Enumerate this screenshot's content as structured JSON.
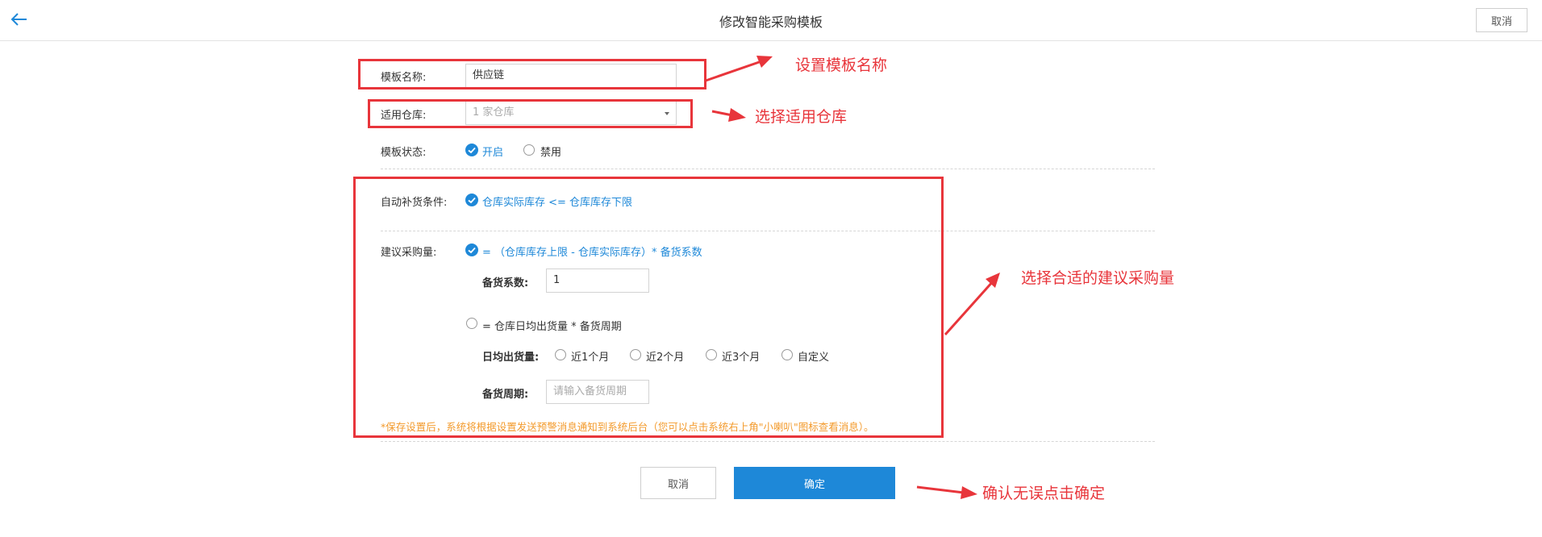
{
  "header": {
    "title": "修改智能采购模板",
    "cancel_label": "取消"
  },
  "form": {
    "name_label": "模板名称:",
    "name_value": "供应链",
    "warehouse_label": "适用仓库:",
    "warehouse_value": "1 家仓库",
    "status_label": "模板状态:",
    "status_on": "开启",
    "status_off": "禁用",
    "auto_label": "自动补货条件:",
    "auto_option": "仓库实际库存 <= 仓库库存下限",
    "qty_label": "建议采购量:",
    "qty_option_1": "= （仓库库存上限 - 仓库实际库存）* 备货系数",
    "coef_label": "备货系数:",
    "coef_value": "1",
    "qty_option_2": "= 仓库日均出货量 * 备货周期",
    "daily_label": "日均出货量:",
    "daily_options": [
      "近1个月",
      "近2个月",
      "近3个月",
      "自定义"
    ],
    "period_label": "备货周期:",
    "period_placeholder": "请输入备货周期",
    "notice": "*保存设置后，系统将根据设置发送预警消息通知到系统后台（您可以点击系统右上角\"小喇叭\"图标查看消息）。"
  },
  "footer": {
    "cancel_label": "取消",
    "confirm_label": "确定"
  },
  "annotations": {
    "set_name": "设置模板名称",
    "select_warehouse": "选择适用仓库",
    "select_qty": "选择合适的建议采购量",
    "confirm": "确认无误点击确定"
  },
  "colors": {
    "accent": "#1e88d8",
    "annotation": "#e8353b",
    "notice": "#f39a2b"
  }
}
